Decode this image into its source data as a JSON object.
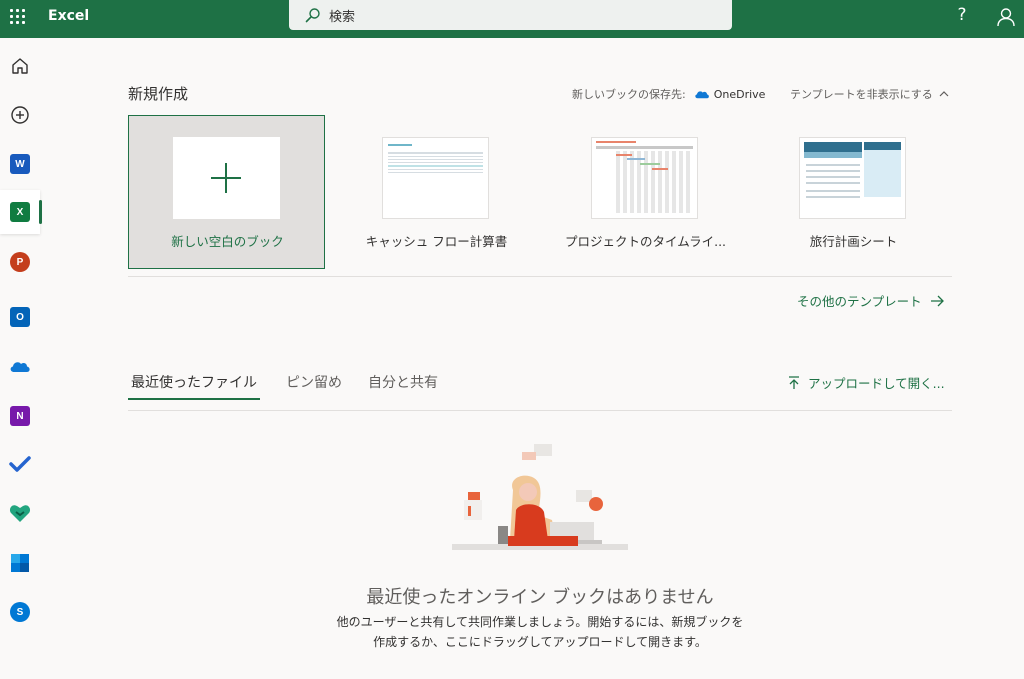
{
  "app": {
    "name": "Excel"
  },
  "search": {
    "placeholder": "検索"
  },
  "header": {
    "help_label": "?"
  },
  "rail": {
    "items": [
      {
        "id": "home",
        "icon": "home-icon"
      },
      {
        "id": "create",
        "icon": "add-circle-icon"
      },
      {
        "id": "word",
        "icon": "word-icon",
        "letter": "W",
        "color": "#185abd"
      },
      {
        "id": "excel",
        "icon": "excel-icon",
        "letter": "X",
        "color": "#107c41"
      },
      {
        "id": "powerpoint",
        "icon": "powerpoint-icon",
        "letter": "P",
        "color": "#c43e1c"
      },
      {
        "id": "outlook",
        "icon": "outlook-icon",
        "letter": "O",
        "color": "#0364b8"
      },
      {
        "id": "onedrive",
        "icon": "onedrive-icon"
      },
      {
        "id": "onenote",
        "icon": "onenote-icon",
        "letter": "N",
        "color": "#7719aa"
      },
      {
        "id": "todo",
        "icon": "todo-icon"
      },
      {
        "id": "family-safety",
        "icon": "family-safety-icon"
      },
      {
        "id": "calendar",
        "icon": "calendar-icon"
      },
      {
        "id": "skype",
        "icon": "skype-icon",
        "letter": "S",
        "color": "#0078d4"
      }
    ]
  },
  "new_section": {
    "title": "新規作成",
    "save_location_label": "新しいブックの保存先:",
    "save_location_value": "OneDrive",
    "hide_templates_label": "テンプレートを非表示にする",
    "templates": [
      {
        "label": "新しい空白のブック"
      },
      {
        "label": "キャッシュ フロー計算書"
      },
      {
        "label": "プロジェクトのタイムライ..."
      },
      {
        "label": "旅行計画シート"
      }
    ],
    "more_templates_label": "その他のテンプレート"
  },
  "files": {
    "tabs": [
      {
        "label": "最近使ったファイル",
        "active": true
      },
      {
        "label": "ピン留め",
        "active": false
      },
      {
        "label": "自分と共有",
        "active": false
      }
    ],
    "upload_label": "アップロードして開く...",
    "empty_title": "最近使ったオンライン ブックはありません",
    "empty_desc": "他のユーザーと共有して共同作業しましょう。開始するには、新規ブックを作成するか、ここにドラッグしてアップロードして開きます。"
  },
  "colors": {
    "brand": "#1e7145",
    "background": "#faf9f8"
  }
}
